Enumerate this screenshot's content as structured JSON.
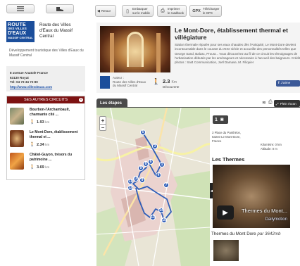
{
  "sidebar": {
    "logo": {
      "line1": "ROUTE",
      "line2": "DES VILLES",
      "line3": "D'EAUX",
      "line4": "MASSIF CENTRAL"
    },
    "site_name": "Route des Villes d'Eaux du Massif Central",
    "description": "Développement touristique des Villes d'Eaux du Massif Central",
    "address_line1": "8 avenue Anatole France",
    "address_line2": "63130 Royat",
    "phone": "Tel: 04 73 34 72 80",
    "website": "http://www.villesdeaux.com",
    "circuits_title": "SES AUTRES CIRCUITS",
    "circuits": [
      {
        "name": "Bourbon-l'Archambault, charmante cité ...",
        "km": "1.93",
        "unit": "km"
      },
      {
        "name": "Le Mont-Dore, établissement thermal et ...",
        "km": "2.34",
        "unit": "km"
      },
      {
        "name": "Châtel-Guyon, trésors du patrimoine ...",
        "km": "3.69",
        "unit": "km"
      }
    ]
  },
  "toolbar": {
    "back": "Retour",
    "embed_l1": "Embarquer",
    "embed_l2": "sur le mobile",
    "print_l1": "Imprimer",
    "print_l2": "le roadbook",
    "gpx_icon": "GPX",
    "gpx_l1": "Télécharger",
    "gpx_l2": "le GPX"
  },
  "header": {
    "title": "Le Mont-Dore, établissement thermal et villégiature",
    "text": "Station thermale réputée pour ses eaux chaudes dès l'Antiquité, Le Mont-Dore devient incontournable dans le courant du XIXe siècle et accueille des personnalités telles que George Sand, Balzac, Proust... Vous découvrirez au fil de ce circuit les témoignages de l'urbanisation débutée par les aménageurs et nécessaire à l'accueil des baigneurs. Crédit photos : Sat4 Communication, Joël Damase, M. Filiquier",
    "author_label": "Auteur :",
    "author_name": "Route des Villes d'Eaux du Massif Central",
    "distance": "2.3",
    "distance_unit": "Km",
    "mode": "Découverte",
    "share": "J'aime"
  },
  "stages": {
    "tab": "Les étapes",
    "fullscreen": "Plein écran"
  },
  "map": {
    "markers": [
      "5",
      "3",
      "1",
      "8",
      "6",
      "9",
      "4",
      "7",
      "9",
      "11",
      "10",
      "12",
      "14",
      "13",
      "15"
    ]
  },
  "panel": {
    "step": "1",
    "address_l1": "3 Place du Panthéon,",
    "address_l2": "63240 Le Mont-Dore,",
    "address_l3": "France",
    "distance_row": "Kilomètre: 0 km",
    "altitude_row": "Altitude: 0 m",
    "section": "Les Thermes",
    "video_title": "Thermes du Mont...",
    "video_brand": "Dailymotion",
    "caption_title": "Thermes du Mont Dore",
    "caption_by": "par 3642mb"
  }
}
